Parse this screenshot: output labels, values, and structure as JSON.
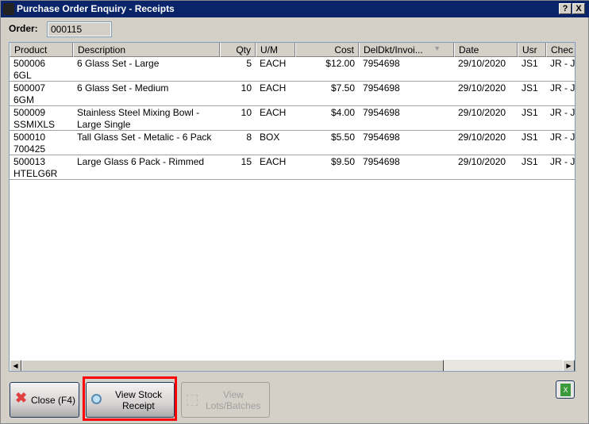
{
  "window": {
    "title": "Purchase Order Enquiry - Receipts",
    "help": "?",
    "close": "X"
  },
  "order": {
    "label": "Order:",
    "value": "000115"
  },
  "columns": [
    "Product",
    "Description",
    "Qty",
    "U/M",
    "Cost",
    "DelDkt/Invoi...",
    "Date",
    "Usr",
    "Chec"
  ],
  "rows": [
    {
      "product": "500006",
      "product2": "6GL",
      "description": "6 Glass Set - Large",
      "description2": "",
      "qty": "5",
      "um": "EACH",
      "cost": "$12.00",
      "deldkt": "7954698",
      "date": "29/10/2020",
      "usr": "JS1",
      "check": "JR - J"
    },
    {
      "product": "500007",
      "product2": "6GM",
      "description": "6 Glass Set - Medium",
      "description2": "",
      "qty": "10",
      "um": "EACH",
      "cost": "$7.50",
      "deldkt": "7954698",
      "date": "29/10/2020",
      "usr": "JS1",
      "check": "JR - J"
    },
    {
      "product": "500009",
      "product2": "SSMIXLS",
      "description": "Stainless Steel Mixing Bowl -",
      "description2": "Large Single",
      "qty": "10",
      "um": "EACH",
      "cost": "$4.00",
      "deldkt": "7954698",
      "date": "29/10/2020",
      "usr": "JS1",
      "check": "JR - J"
    },
    {
      "product": "500010",
      "product2": "700425",
      "description": "Tall Glass Set - Metalic - 6 Pack",
      "description2": "",
      "qty": "8",
      "um": "BOX",
      "cost": "$5.50",
      "deldkt": "7954698",
      "date": "29/10/2020",
      "usr": "JS1",
      "check": "JR - J"
    },
    {
      "product": "500013",
      "product2": "HTELG6R",
      "description": "Large Glass 6 Pack - Rimmed",
      "description2": "",
      "qty": "15",
      "um": "EACH",
      "cost": "$9.50",
      "deldkt": "7954698",
      "date": "29/10/2020",
      "usr": "JS1",
      "check": "JR - J"
    }
  ],
  "buttons": {
    "close": "Close (F4)",
    "view_stock_line1": "View Stock",
    "view_stock_line2": "Receipt",
    "view_lots_line1": "View",
    "view_lots_line2": "Lots/Batches"
  },
  "icons": {
    "close": "red-x-icon",
    "view_stock": "magnifier-icon",
    "view_lots": "lots-icon",
    "export": "excel-icon"
  }
}
